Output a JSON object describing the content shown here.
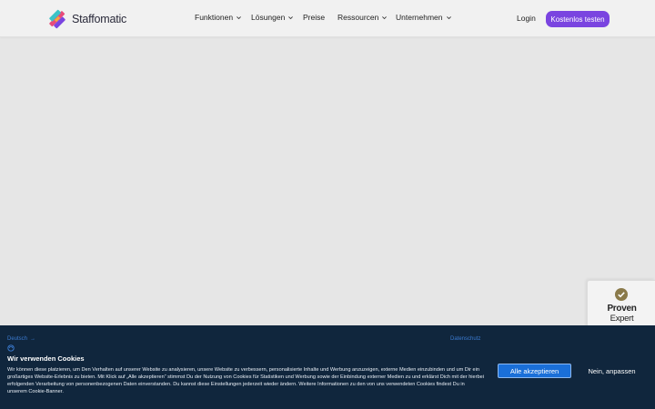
{
  "header": {
    "brand": "Staffomatic",
    "nav": [
      {
        "label": "Funktionen",
        "has_dropdown": true
      },
      {
        "label": "Lösungen",
        "has_dropdown": true
      },
      {
        "label": "Preise",
        "has_dropdown": false
      },
      {
        "label": "Ressourcen",
        "has_dropdown": true
      },
      {
        "label": "Unternehmen",
        "has_dropdown": true
      }
    ],
    "login_label": "Login",
    "cta_label": "Kostenlos testen",
    "accent_color": "#7a44e0"
  },
  "badge": {
    "line1": "Proven",
    "line2": "Expert"
  },
  "cookie_banner": {
    "language_label": "Deutsch",
    "language_arrow": "→",
    "privacy_link": "Datenschutz",
    "title": "Wir verwenden Cookies",
    "body": "Wir können diese platzieren, um Den Verhalten auf unserer Website zu analysieren, unsere Website zu verbessern, personalisierte Inhalte und Werbung anzuzeigen, externe Medien einzubinden und um Dir ein großartiges Website-Erlebnis zu bieten. Mit Klick auf „Alle akzeptieren“ stimmst Du der Nutzung von Cookies für Statistiken und Werbung sowie der Einbindung externer Medien zu und erklärst Dich mit der hierbei erfolgenden Verarbeitung von personenbezogenen Daten einverstanden. Du kannst diese Einstellungen jederzeit wieder ändern. Weitere Informationen zu den von uns verwendeten Cookies findest Du in unserem Cookie-Banner.",
    "accept_label": "Alle akzeptieren",
    "reject_label": "Nein, anpassen",
    "background_color": "#10263d",
    "button_color": "#1a6fd8"
  }
}
